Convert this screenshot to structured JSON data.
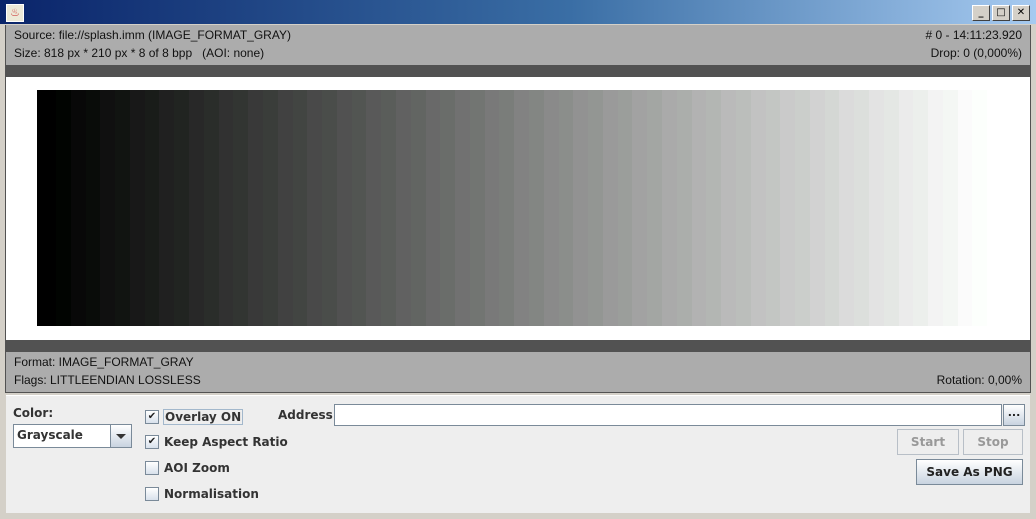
{
  "window": {
    "title": "",
    "buttons": [
      "minimize",
      "maximize",
      "close"
    ]
  },
  "header_info": {
    "source": "Source: file://splash.imm (IMAGE_FORMAT_GRAY)",
    "size": "Size: 818 px * 210 px * 8 of 8 bpp   (AOI: none)",
    "frame": "# 0 - 14:11:23.920",
    "drop": "Drop: 0 (0,000%)"
  },
  "footer_info": {
    "format": "Format: IMAGE_FORMAT_GRAY",
    "flags": "Flags: LITTLEENDIAN LOSSLESS",
    "rotation": "Rotation: 0,00%"
  },
  "image": {
    "description": "grayscale step gradient, black to white",
    "band_count": 64
  },
  "controls": {
    "color_label": "Color:",
    "color_value": "Grayscale",
    "checkboxes": [
      {
        "label": "Overlay ON",
        "checked": true
      },
      {
        "label": "Keep Aspect Ratio",
        "checked": true
      },
      {
        "label": "AOI Zoom",
        "checked": false
      },
      {
        "label": "Normalisation",
        "checked": false
      }
    ],
    "address_label": "Address:",
    "address_value": "",
    "browse_label": "...",
    "start_label": "Start",
    "stop_label": "Stop",
    "save_label": "Save As PNG"
  }
}
